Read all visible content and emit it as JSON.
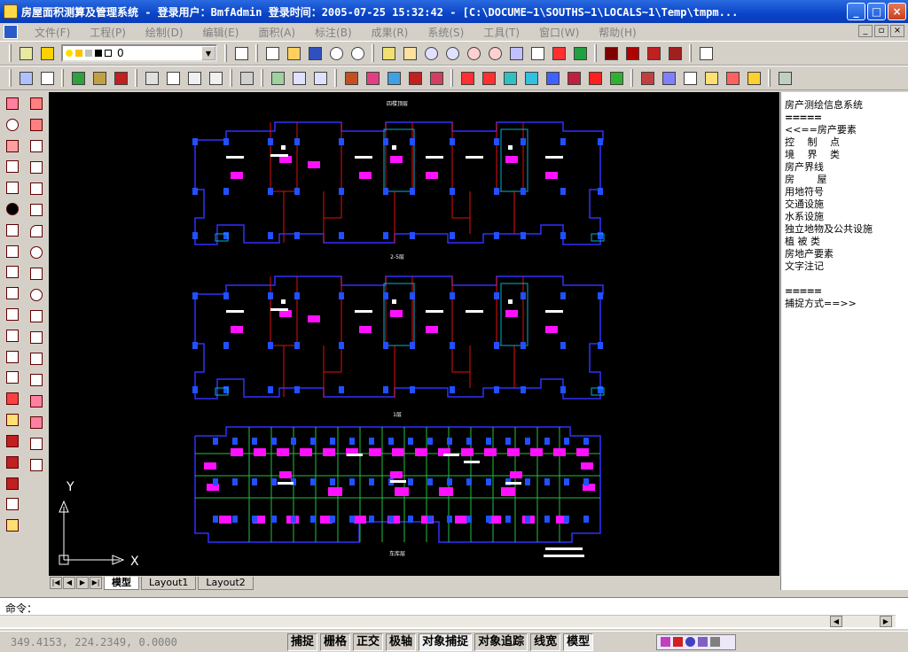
{
  "window": {
    "title": "房屋面积测算及管理系统 - 登录用户：BmfAdmin  登录时间：2005-07-25 15:32:42 - [C:\\DOCUME~1\\SOUTHS~1\\LOCALS~1\\Temp\\tmpm...",
    "minimize_label": "_",
    "maximize_label": "□",
    "close_label": "×"
  },
  "menubar": {
    "items": [
      "文件(F)",
      "工程(P)",
      "绘制(D)",
      "编辑(E)",
      "面积(A)",
      "标注(B)",
      "成果(R)",
      "系统(S)",
      "工具(T)",
      "窗口(W)",
      "帮助(H)"
    ],
    "mdi_min": "_",
    "mdi_restore": "▫",
    "mdi_close": "×"
  },
  "layer_combo": {
    "value": "0"
  },
  "drawing": {
    "floor_labels": [
      "四楼顶层",
      "2-5层",
      "1层",
      "车库层"
    ],
    "axis_x": "X",
    "axis_y": "Y"
  },
  "layout_tabs": [
    "模型",
    "Layout1",
    "Layout2"
  ],
  "right_panel": {
    "lines": [
      "房产测绘信息系统",
      "=====",
      "<<==房产要素",
      "控　 制　 点",
      "境　 界　 类",
      "房产界线",
      "房　　 屋",
      "用地符号",
      "交通设施",
      "水系设施",
      "独立地物及公共设施",
      "植 被 类",
      "房地产要素",
      "文字注记",
      "",
      "=====",
      "捕捉方式==>>"
    ]
  },
  "command": {
    "label": "命令："
  },
  "status": {
    "coords": "349.4153, 224.2349, 0.0000",
    "buttons": [
      "捕捉",
      "栅格",
      "正交",
      "极轴",
      "对象捕捉",
      "对象追踪",
      "线宽",
      "模型"
    ]
  },
  "colors": {
    "wall": "#3030ff",
    "column": "#2050ff",
    "room_line": "#e01010",
    "fixture": "#ff10ff",
    "stair": "#00b0d0",
    "label": "#ffffff",
    "green_line": "#20c040"
  }
}
